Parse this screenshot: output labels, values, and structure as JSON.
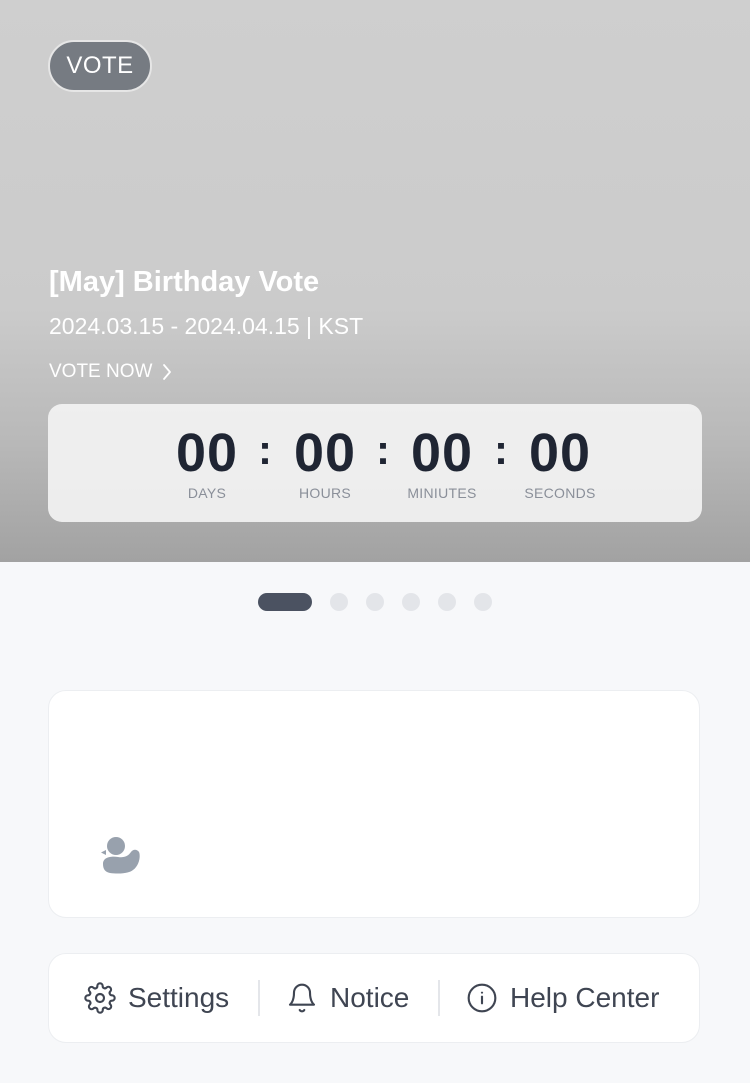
{
  "hero": {
    "badge": "VOTE",
    "title": "[May] Birthday Vote",
    "dates": "2024.03.15 - 2024.04.15 | KST",
    "cta": "VOTE NOW",
    "cta_icon": "chevron-right-icon"
  },
  "countdown": {
    "separator": ":",
    "units": [
      {
        "value": "00",
        "label": "DAYS"
      },
      {
        "value": "00",
        "label": "HOURS"
      },
      {
        "value": "00",
        "label": "MINIUTES"
      },
      {
        "value": "00",
        "label": "SECONDS"
      }
    ]
  },
  "carousel": {
    "count": 6,
    "active_index": 0
  },
  "card": {
    "icon": "duck-icon"
  },
  "menu": {
    "settings": {
      "label": "Settings",
      "icon": "gear-icon"
    },
    "notice": {
      "label": "Notice",
      "icon": "bell-icon"
    },
    "help": {
      "label": "Help Center",
      "icon": "info-icon"
    }
  },
  "colors": {
    "badge_bg": "#767b82",
    "countdown_text": "#1f2533",
    "dot_active": "#4b5261",
    "dot_inactive": "#e3e5e9",
    "menu_text": "#3f4552"
  }
}
